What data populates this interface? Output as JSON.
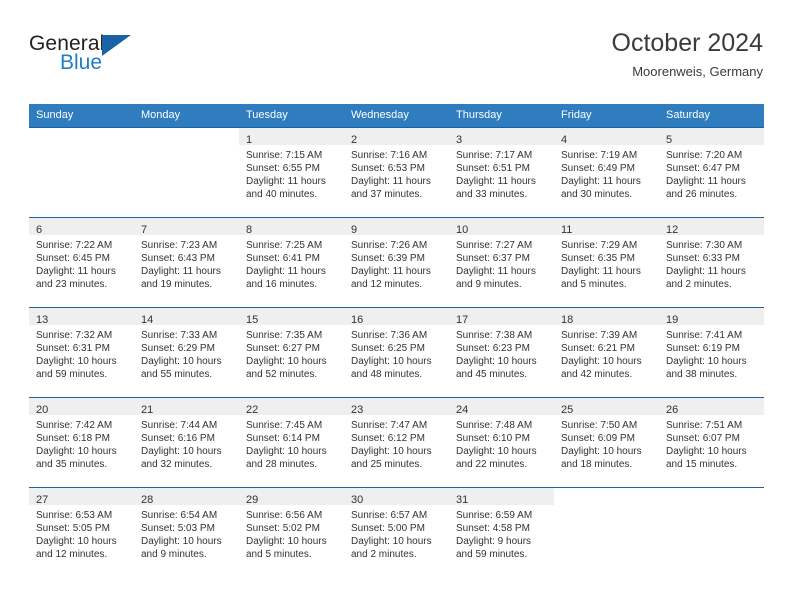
{
  "brand": {
    "name_top": "General",
    "name_bottom": "Blue",
    "logo_color": "#1763a6",
    "text_color": "#1f7fc4"
  },
  "header": {
    "title": "October 2024",
    "subtitle": "Moorenweis, Germany"
  },
  "theme": {
    "header_bg": "#2f7cbf",
    "row_divider": "#1763a6",
    "daynum_band": "#efefef"
  },
  "weekdays": [
    "Sunday",
    "Monday",
    "Tuesday",
    "Wednesday",
    "Thursday",
    "Friday",
    "Saturday"
  ],
  "weeks": [
    [
      {
        "day": "",
        "empty": true
      },
      {
        "day": "",
        "empty": true
      },
      {
        "day": "1",
        "sunrise": "Sunrise: 7:15 AM",
        "sunset": "Sunset: 6:55 PM",
        "daylight1": "Daylight: 11 hours",
        "daylight2": "and 40 minutes."
      },
      {
        "day": "2",
        "sunrise": "Sunrise: 7:16 AM",
        "sunset": "Sunset: 6:53 PM",
        "daylight1": "Daylight: 11 hours",
        "daylight2": "and 37 minutes."
      },
      {
        "day": "3",
        "sunrise": "Sunrise: 7:17 AM",
        "sunset": "Sunset: 6:51 PM",
        "daylight1": "Daylight: 11 hours",
        "daylight2": "and 33 minutes."
      },
      {
        "day": "4",
        "sunrise": "Sunrise: 7:19 AM",
        "sunset": "Sunset: 6:49 PM",
        "daylight1": "Daylight: 11 hours",
        "daylight2": "and 30 minutes."
      },
      {
        "day": "5",
        "sunrise": "Sunrise: 7:20 AM",
        "sunset": "Sunset: 6:47 PM",
        "daylight1": "Daylight: 11 hours",
        "daylight2": "and 26 minutes."
      }
    ],
    [
      {
        "day": "6",
        "sunrise": "Sunrise: 7:22 AM",
        "sunset": "Sunset: 6:45 PM",
        "daylight1": "Daylight: 11 hours",
        "daylight2": "and 23 minutes."
      },
      {
        "day": "7",
        "sunrise": "Sunrise: 7:23 AM",
        "sunset": "Sunset: 6:43 PM",
        "daylight1": "Daylight: 11 hours",
        "daylight2": "and 19 minutes."
      },
      {
        "day": "8",
        "sunrise": "Sunrise: 7:25 AM",
        "sunset": "Sunset: 6:41 PM",
        "daylight1": "Daylight: 11 hours",
        "daylight2": "and 16 minutes."
      },
      {
        "day": "9",
        "sunrise": "Sunrise: 7:26 AM",
        "sunset": "Sunset: 6:39 PM",
        "daylight1": "Daylight: 11 hours",
        "daylight2": "and 12 minutes."
      },
      {
        "day": "10",
        "sunrise": "Sunrise: 7:27 AM",
        "sunset": "Sunset: 6:37 PM",
        "daylight1": "Daylight: 11 hours",
        "daylight2": "and 9 minutes."
      },
      {
        "day": "11",
        "sunrise": "Sunrise: 7:29 AM",
        "sunset": "Sunset: 6:35 PM",
        "daylight1": "Daylight: 11 hours",
        "daylight2": "and 5 minutes."
      },
      {
        "day": "12",
        "sunrise": "Sunrise: 7:30 AM",
        "sunset": "Sunset: 6:33 PM",
        "daylight1": "Daylight: 11 hours",
        "daylight2": "and 2 minutes."
      }
    ],
    [
      {
        "day": "13",
        "sunrise": "Sunrise: 7:32 AM",
        "sunset": "Sunset: 6:31 PM",
        "daylight1": "Daylight: 10 hours",
        "daylight2": "and 59 minutes."
      },
      {
        "day": "14",
        "sunrise": "Sunrise: 7:33 AM",
        "sunset": "Sunset: 6:29 PM",
        "daylight1": "Daylight: 10 hours",
        "daylight2": "and 55 minutes."
      },
      {
        "day": "15",
        "sunrise": "Sunrise: 7:35 AM",
        "sunset": "Sunset: 6:27 PM",
        "daylight1": "Daylight: 10 hours",
        "daylight2": "and 52 minutes."
      },
      {
        "day": "16",
        "sunrise": "Sunrise: 7:36 AM",
        "sunset": "Sunset: 6:25 PM",
        "daylight1": "Daylight: 10 hours",
        "daylight2": "and 48 minutes."
      },
      {
        "day": "17",
        "sunrise": "Sunrise: 7:38 AM",
        "sunset": "Sunset: 6:23 PM",
        "daylight1": "Daylight: 10 hours",
        "daylight2": "and 45 minutes."
      },
      {
        "day": "18",
        "sunrise": "Sunrise: 7:39 AM",
        "sunset": "Sunset: 6:21 PM",
        "daylight1": "Daylight: 10 hours",
        "daylight2": "and 42 minutes."
      },
      {
        "day": "19",
        "sunrise": "Sunrise: 7:41 AM",
        "sunset": "Sunset: 6:19 PM",
        "daylight1": "Daylight: 10 hours",
        "daylight2": "and 38 minutes."
      }
    ],
    [
      {
        "day": "20",
        "sunrise": "Sunrise: 7:42 AM",
        "sunset": "Sunset: 6:18 PM",
        "daylight1": "Daylight: 10 hours",
        "daylight2": "and 35 minutes."
      },
      {
        "day": "21",
        "sunrise": "Sunrise: 7:44 AM",
        "sunset": "Sunset: 6:16 PM",
        "daylight1": "Daylight: 10 hours",
        "daylight2": "and 32 minutes."
      },
      {
        "day": "22",
        "sunrise": "Sunrise: 7:45 AM",
        "sunset": "Sunset: 6:14 PM",
        "daylight1": "Daylight: 10 hours",
        "daylight2": "and 28 minutes."
      },
      {
        "day": "23",
        "sunrise": "Sunrise: 7:47 AM",
        "sunset": "Sunset: 6:12 PM",
        "daylight1": "Daylight: 10 hours",
        "daylight2": "and 25 minutes."
      },
      {
        "day": "24",
        "sunrise": "Sunrise: 7:48 AM",
        "sunset": "Sunset: 6:10 PM",
        "daylight1": "Daylight: 10 hours",
        "daylight2": "and 22 minutes."
      },
      {
        "day": "25",
        "sunrise": "Sunrise: 7:50 AM",
        "sunset": "Sunset: 6:09 PM",
        "daylight1": "Daylight: 10 hours",
        "daylight2": "and 18 minutes."
      },
      {
        "day": "26",
        "sunrise": "Sunrise: 7:51 AM",
        "sunset": "Sunset: 6:07 PM",
        "daylight1": "Daylight: 10 hours",
        "daylight2": "and 15 minutes."
      }
    ],
    [
      {
        "day": "27",
        "sunrise": "Sunrise: 6:53 AM",
        "sunset": "Sunset: 5:05 PM",
        "daylight1": "Daylight: 10 hours",
        "daylight2": "and 12 minutes."
      },
      {
        "day": "28",
        "sunrise": "Sunrise: 6:54 AM",
        "sunset": "Sunset: 5:03 PM",
        "daylight1": "Daylight: 10 hours",
        "daylight2": "and 9 minutes."
      },
      {
        "day": "29",
        "sunrise": "Sunrise: 6:56 AM",
        "sunset": "Sunset: 5:02 PM",
        "daylight1": "Daylight: 10 hours",
        "daylight2": "and 5 minutes."
      },
      {
        "day": "30",
        "sunrise": "Sunrise: 6:57 AM",
        "sunset": "Sunset: 5:00 PM",
        "daylight1": "Daylight: 10 hours",
        "daylight2": "and 2 minutes."
      },
      {
        "day": "31",
        "sunrise": "Sunrise: 6:59 AM",
        "sunset": "Sunset: 4:58 PM",
        "daylight1": "Daylight: 9 hours",
        "daylight2": "and 59 minutes."
      },
      {
        "day": "",
        "empty": true
      },
      {
        "day": "",
        "empty": true
      }
    ]
  ]
}
